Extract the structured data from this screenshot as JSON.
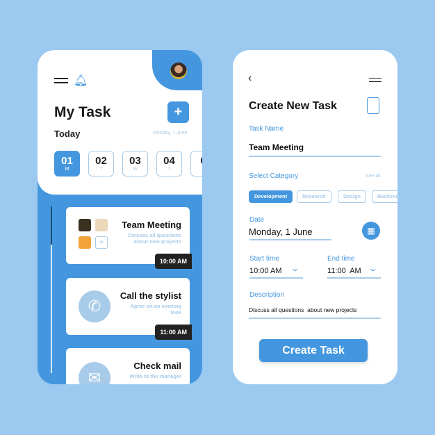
{
  "left": {
    "title": "My Task",
    "today": "Today",
    "date": "Monday, 1 June",
    "days": [
      {
        "n": "01",
        "l": "M"
      },
      {
        "n": "02",
        "l": "T"
      },
      {
        "n": "03",
        "l": "W"
      },
      {
        "n": "04",
        "l": "T"
      },
      {
        "n": "0",
        "l": ""
      }
    ],
    "tasks": [
      {
        "title": "Team Meeting",
        "desc": "Discuss all questions about new projects",
        "time": "10:00 AM"
      },
      {
        "title": "Call the stylist",
        "desc": "Agree on an evening look",
        "time": "11:00 AM"
      },
      {
        "title": "Check mail",
        "desc": "Write to the manager"
      }
    ]
  },
  "right": {
    "title": "Create New Task",
    "task_name_label": "Task Name",
    "task_name": "Team Meeting",
    "category_label": "Select Category",
    "see_all": "See all",
    "categories": [
      "Development",
      "Research",
      "Design",
      "Backend"
    ],
    "date_label": "Date",
    "date": "Monday, 1 June",
    "start_label": "Start time",
    "start": "10:00 AM",
    "end_label": "End time",
    "end": "11:00  AM",
    "desc_label": "Description",
    "desc": "Discuss all questions  about new projects",
    "button": "Create Task"
  },
  "colors": {
    "accent": "#4497de",
    "light": "#a8cbe9",
    "bg": "#9cc9f0"
  }
}
